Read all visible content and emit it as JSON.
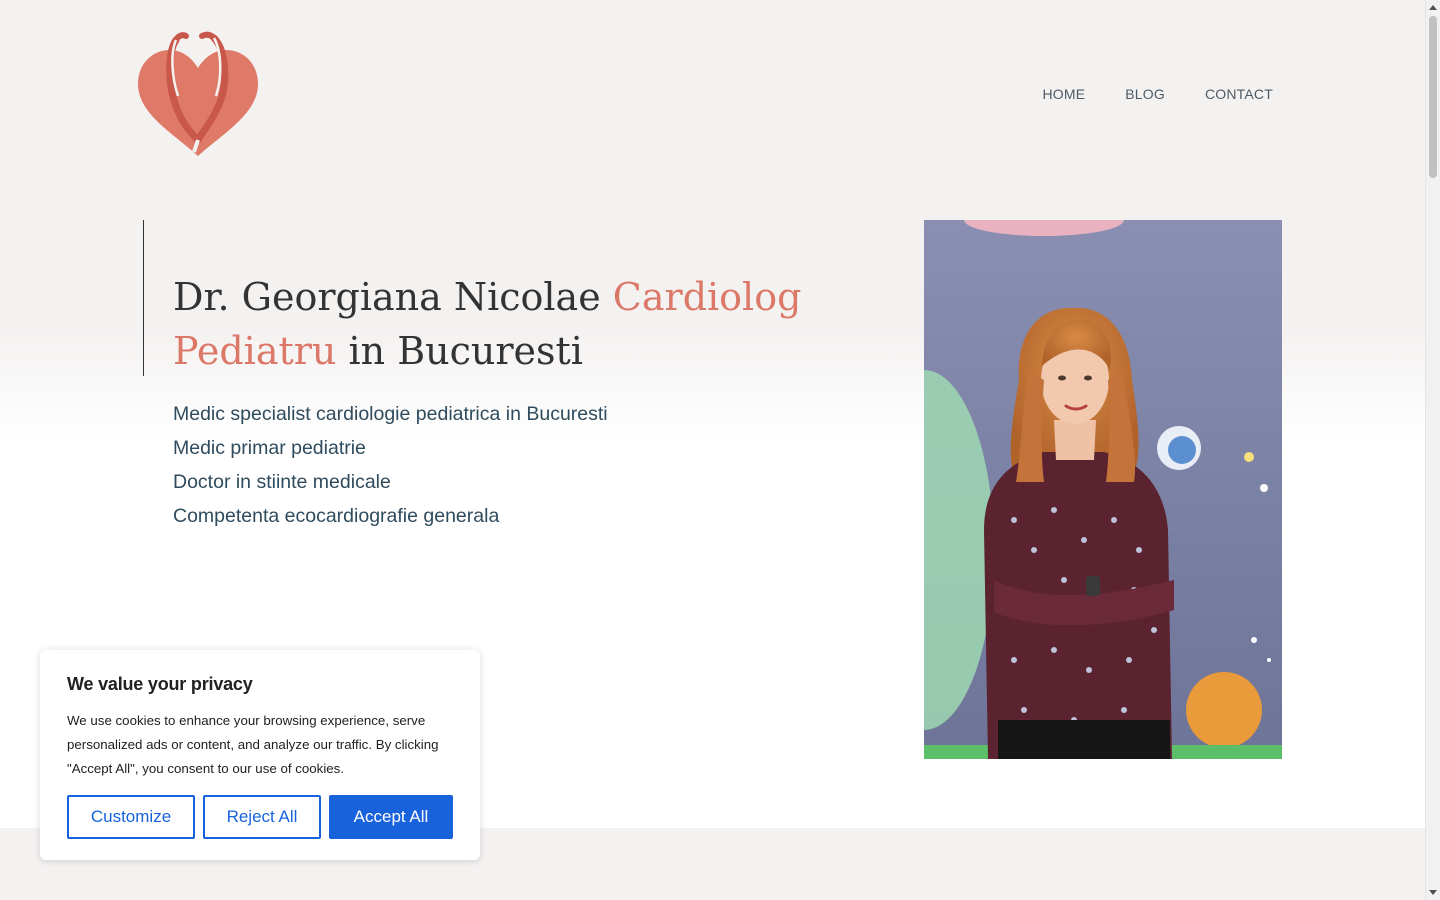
{
  "brand": {
    "logo_icon": "heart-stethoscope-icon",
    "accent_color": "#db7868"
  },
  "nav": {
    "items": [
      {
        "label": "HOME"
      },
      {
        "label": "BLOG"
      },
      {
        "label": "CONTACT"
      }
    ]
  },
  "hero": {
    "title_part1": "Dr. Georgiana Nicolae ",
    "title_accent": "Cardiolog Pediatru",
    "title_part2": " in Bucuresti",
    "credentials": [
      "Medic specialist cardiologie pediatrica in Bucuresti",
      "Medic primar pediatrie",
      "Doctor in stiinte medicale",
      "Competenta ecocardiografie generala"
    ],
    "photo_icon": "doctor-portrait-photo"
  },
  "cookie": {
    "title": "We value your privacy",
    "body": "We use cookies to enhance your browsing experience, serve personalized ads or content, and analyze our traffic. By clicking \"Accept All\", you consent to our use of cookies.",
    "customize_label": "Customize",
    "reject_label": "Reject All",
    "accept_label": "Accept All",
    "button_color": "#1863dc"
  }
}
